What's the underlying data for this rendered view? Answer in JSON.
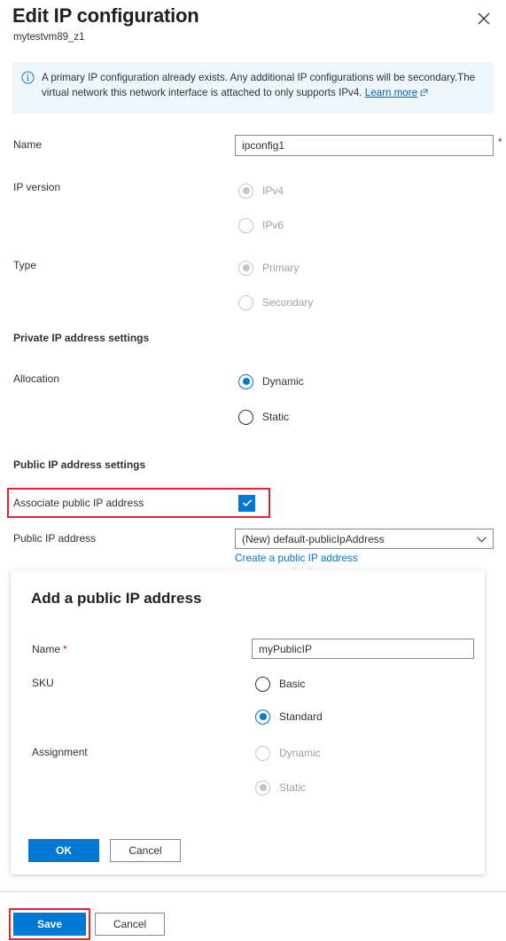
{
  "header": {
    "title": "Edit IP configuration",
    "subtitle": "mytestvm89_z1",
    "close_icon": "close-icon"
  },
  "info_banner": {
    "icon": "info-circle-icon",
    "message": "A primary IP configuration already exists. Any additional IP configurations will be secondary.The virtual network this network interface is attached to only supports IPv4.",
    "link_label": "Learn more",
    "link_icon": "external-link-icon",
    "background_color": "#eff6fc"
  },
  "form": {
    "name": {
      "label": "Name",
      "value": "ipconfig1",
      "placeholder": "",
      "required_marker": "*"
    },
    "ip_version": {
      "label": "IP version",
      "options": [
        {
          "label": "IPv4",
          "selected": true,
          "disabled": true
        },
        {
          "label": "IPv6",
          "selected": false,
          "disabled": true
        }
      ]
    },
    "type": {
      "label": "Type",
      "options": [
        {
          "label": "Primary",
          "selected": true,
          "disabled": true
        },
        {
          "label": "Secondary",
          "selected": false,
          "disabled": true
        }
      ]
    },
    "private_section_heading": "Private IP address settings",
    "allocation": {
      "label": "Allocation",
      "options": [
        {
          "label": "Dynamic",
          "selected": true,
          "disabled": false
        },
        {
          "label": "Static",
          "selected": false,
          "disabled": false
        }
      ]
    },
    "public_section_heading": "Public IP address settings",
    "associate_public_ip": {
      "label": "Associate public IP address",
      "checked": true,
      "check_icon": "checkmark-icon"
    },
    "public_ip_address": {
      "label": "Public IP address",
      "selected_value": "(New) default-publicIpAddress",
      "chevron_icon": "chevron-down-icon",
      "create_link": "Create a public IP address"
    }
  },
  "callout": {
    "title": "Add a public IP address",
    "name": {
      "label": "Name",
      "required_marker": "*",
      "value": "myPublicIP",
      "placeholder": ""
    },
    "sku": {
      "label": "SKU",
      "options": [
        {
          "label": "Basic",
          "selected": false,
          "disabled": false
        },
        {
          "label": "Standard",
          "selected": true,
          "disabled": false
        }
      ]
    },
    "assignment": {
      "label": "Assignment",
      "options": [
        {
          "label": "Dynamic",
          "selected": false,
          "disabled": true
        },
        {
          "label": "Static",
          "selected": true,
          "disabled": true
        }
      ]
    },
    "ok_label": "OK",
    "cancel_label": "Cancel"
  },
  "footer": {
    "save_label": "Save",
    "cancel_label": "Cancel"
  },
  "annotations": {
    "color": "#e8212a",
    "targets": [
      "associate-public-ip-checkbox-row",
      "save-button"
    ]
  }
}
